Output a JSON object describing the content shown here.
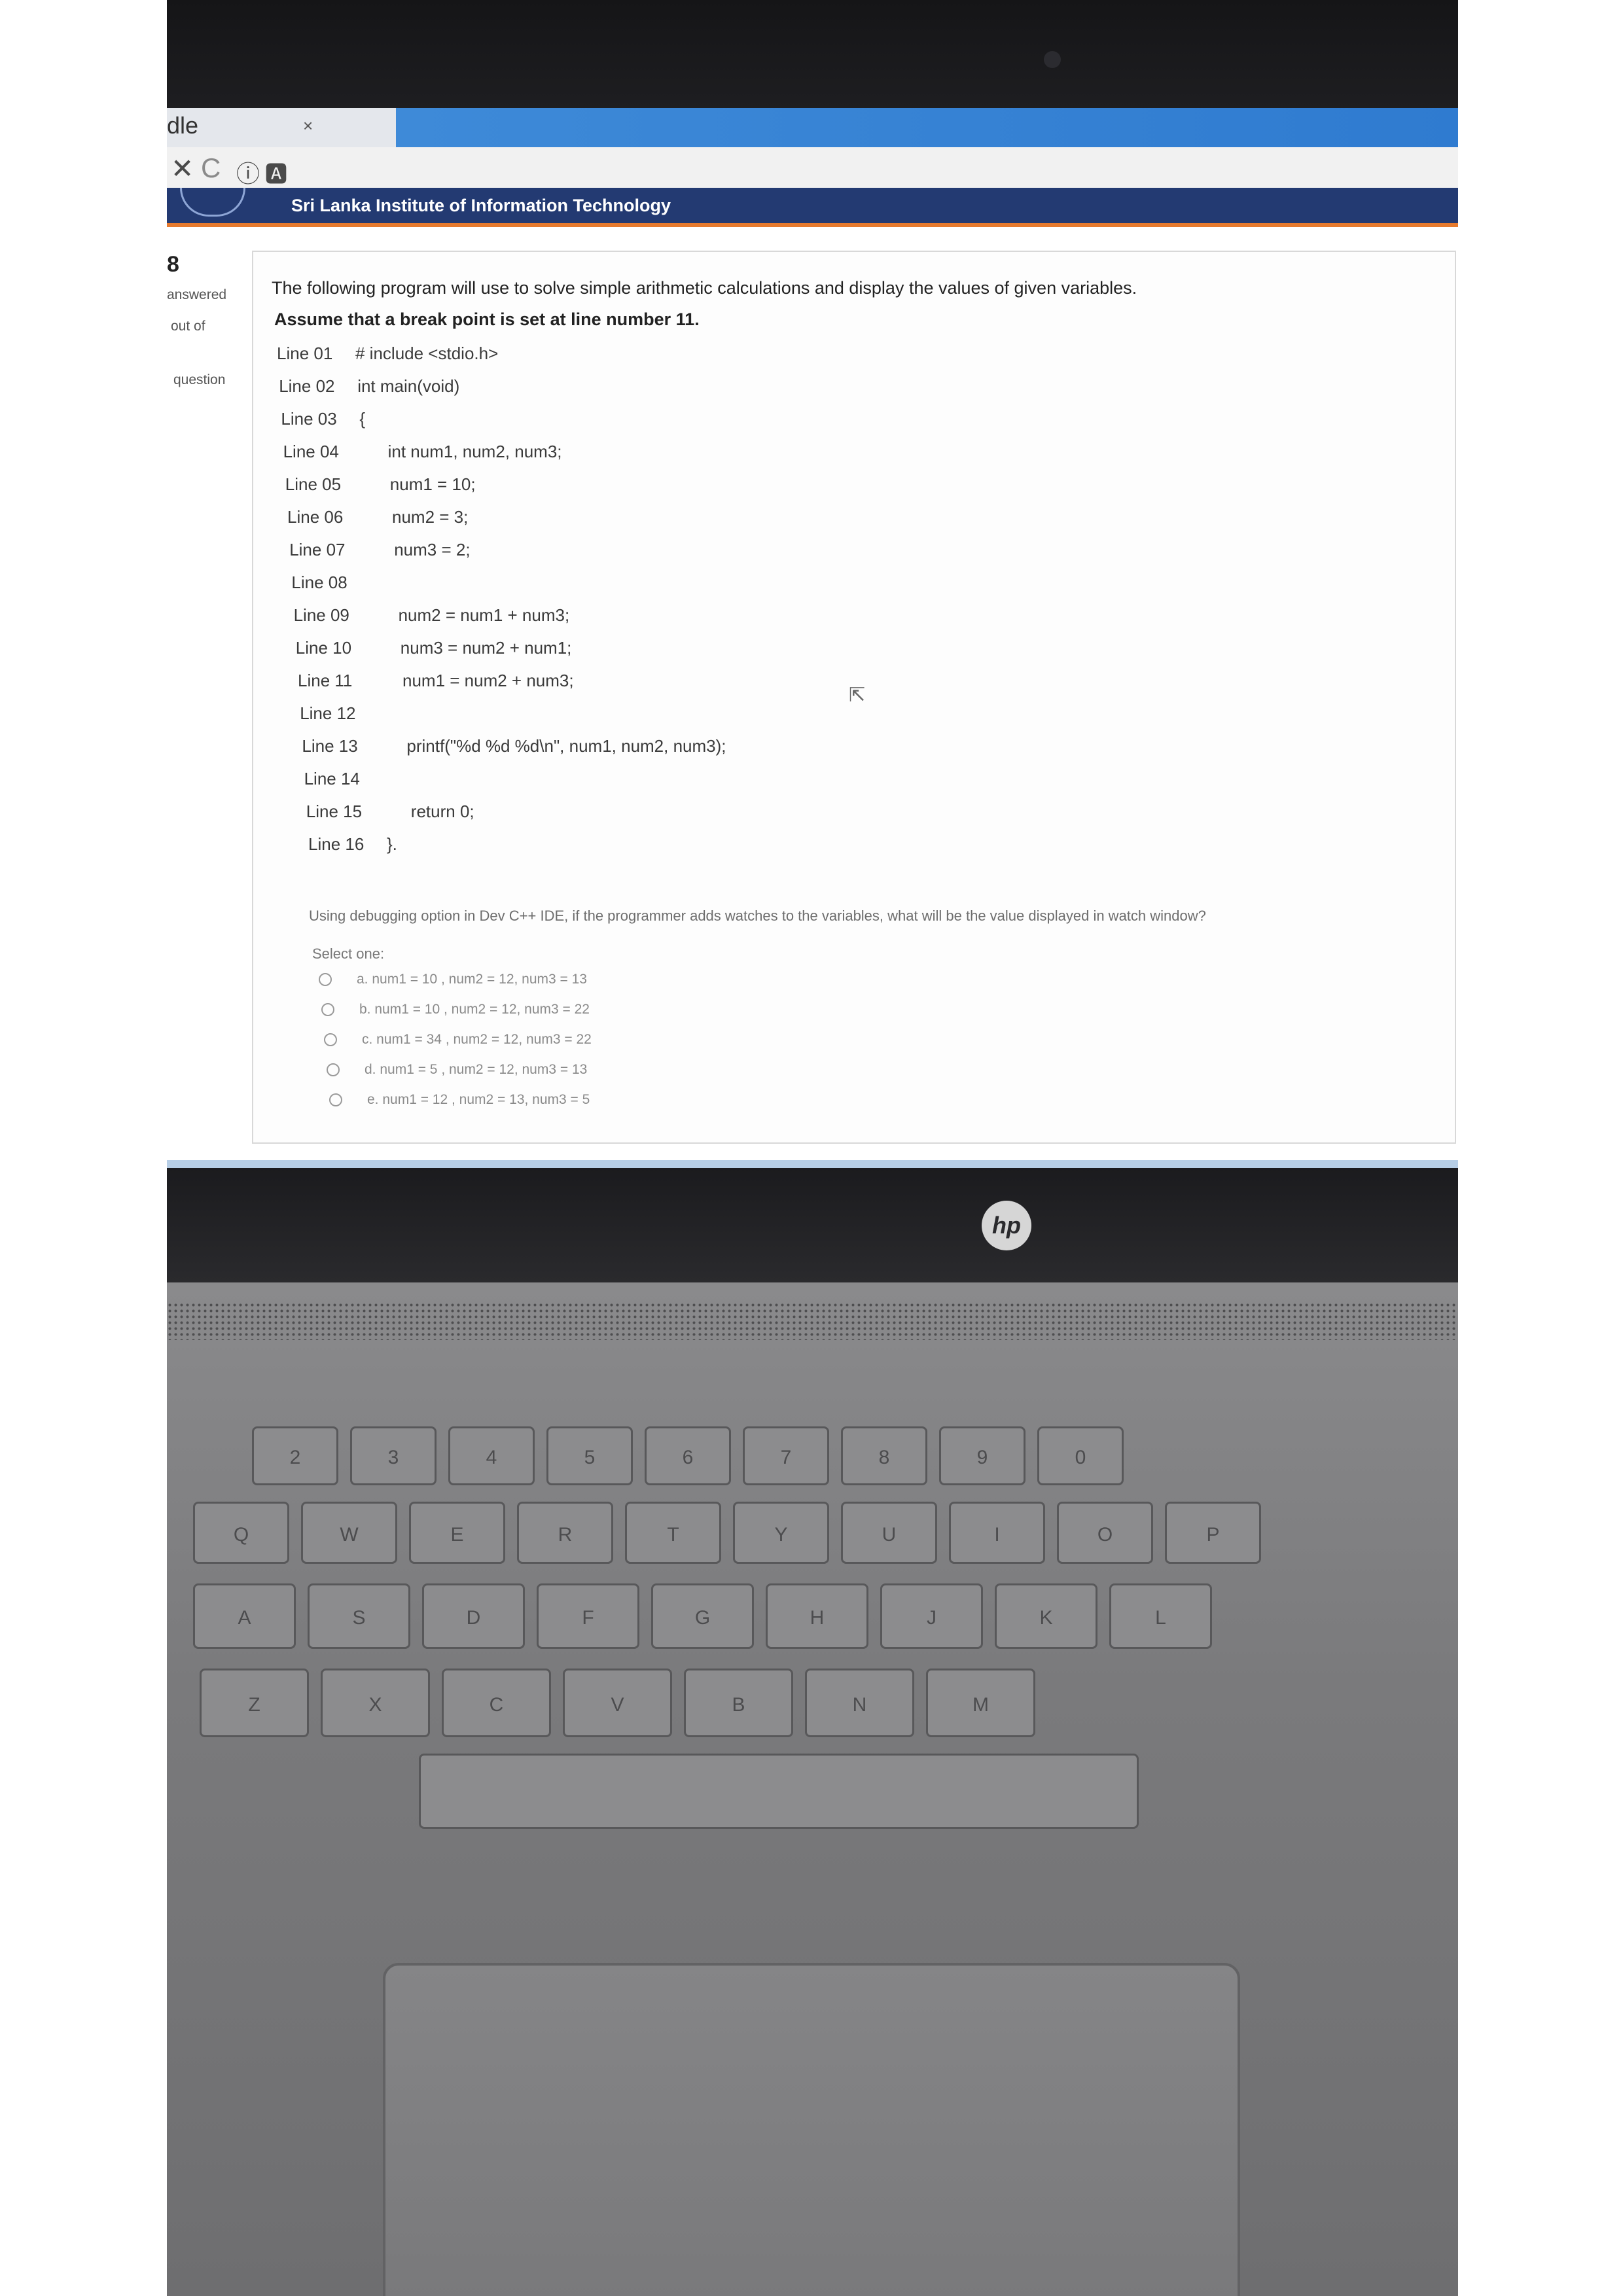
{
  "browser": {
    "tab_title": "dle",
    "tab_close": "×",
    "toolbar_icons": [
      "close-icon",
      "reload-icon",
      "info-icon",
      "page-icon"
    ],
    "toolbar_glyphs": [
      "✕",
      "C",
      "ⓘ",
      "🅰"
    ]
  },
  "site": {
    "name": "Sri Lanka Institute of Information Technology"
  },
  "quiz_nav": {
    "question_number": "8",
    "status": "answered",
    "marks": "out of",
    "flag": "question"
  },
  "question": {
    "intro": "The following program will use to solve simple arithmetic calculations and display the  values of given variables.",
    "breakpoint": "Assume that a  break point is set at line number 11.",
    "code_lines": [
      {
        "line": "Line 01",
        "code": "# include <stdio.h>"
      },
      {
        "line": "Line 02",
        "code": "int main(void)"
      },
      {
        "line": "Line 03",
        "code": "{"
      },
      {
        "line": "Line 04",
        "code": "int num1, num2, num3;"
      },
      {
        "line": "Line 05",
        "code": "num1 = 10;"
      },
      {
        "line": "Line 06",
        "code": "num2 = 3;"
      },
      {
        "line": "Line 07",
        "code": "num3 = 2;"
      },
      {
        "line": "Line 08",
        "code": ""
      },
      {
        "line": "Line 09",
        "code": "num2 = num1 + num3;"
      },
      {
        "line": "Line 10",
        "code": "num3 = num2 + num1;"
      },
      {
        "line": "Line 11",
        "code": "num1 = num2 + num3;"
      },
      {
        "line": "Line 12",
        "code": ""
      },
      {
        "line": "Line 13",
        "code": "printf(\"%d %d %d\\n\", num1, num2, num3);"
      },
      {
        "line": "Line 14",
        "code": ""
      },
      {
        "line": "Line 15",
        "code": "return 0;"
      },
      {
        "line": "Line 16",
        "code": "}."
      }
    ],
    "prompt": "Using debugging option in Dev C++ IDE, if the programmer adds watches to the variables, what will be the value displayed in watch window?",
    "select_label": "Select one:",
    "options": [
      "a. num1 = 10 , num2 = 12, num3 = 13",
      "b. num1 = 10 , num2 = 12, num3 = 22",
      "c. num1 = 34 , num2 = 12, num3 = 22",
      "d. num1 = 5 , num2 = 12, num3 = 13",
      "e. num1 = 12 , num2 = 13, num3 = 5"
    ]
  },
  "laptop": {
    "brand": "hp",
    "keys_row_num": [
      "2",
      "3",
      "4",
      "5",
      "6",
      "7",
      "8",
      "9",
      "0"
    ],
    "keys_row_q": [
      "Q",
      "W",
      "E",
      "R",
      "T",
      "Y",
      "U",
      "I",
      "O",
      "P"
    ],
    "keys_row_a": [
      "A",
      "S",
      "D",
      "F",
      "G",
      "H",
      "J",
      "K",
      "L"
    ],
    "keys_row_z": [
      "Z",
      "X",
      "C",
      "V",
      "B",
      "N",
      "M"
    ]
  }
}
